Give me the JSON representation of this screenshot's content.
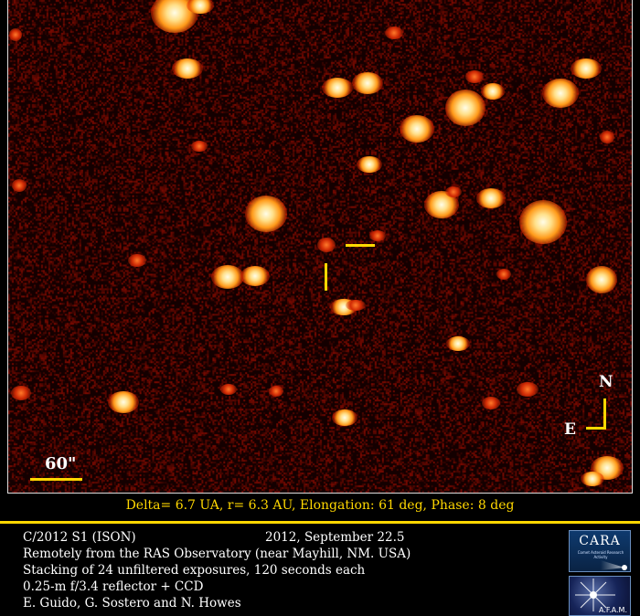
{
  "image": {
    "scale_label": "60\"",
    "north_label": "N",
    "east_label": "E",
    "colors": {
      "marker": "#ffd700",
      "background": "#120000"
    }
  },
  "info_line": "Delta= 6.7 UA,   r= 6.3 AU,   Elongation: 61 deg,   Phase: 8 deg",
  "credits": {
    "object": "C/2012 S1 (ISON)",
    "date": "2012, September 22.5",
    "line2": "Remotely from the RAS Observatory (near Mayhill, NM. USA)",
    "line3": "Stacking of 24 unfiltered exposures, 120 seconds each",
    "line4": "0.25-m f/3.4 reflector + CCD",
    "line5": "E. Guido, G. Sostero and N. Howes"
  },
  "logos": {
    "cara": "CARA",
    "cara_sub": "Comet Asteroid Research Activity",
    "afam": "A.F.A.M."
  }
}
